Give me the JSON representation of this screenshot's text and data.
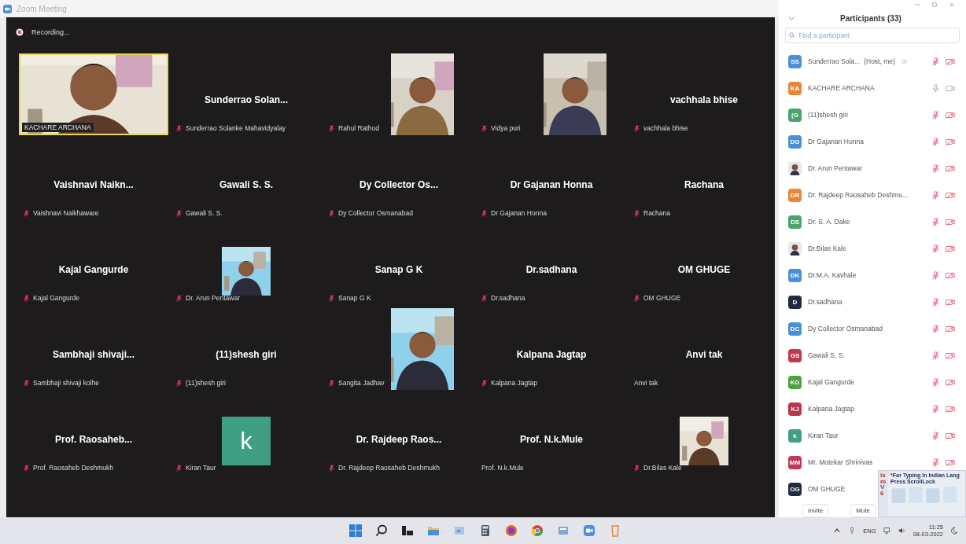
{
  "window": {
    "title": "Zoom Meeting"
  },
  "recording": {
    "label": "Recording..."
  },
  "tiles": [
    {
      "kind": "video",
      "active": true,
      "label": "KACHARE ARCHANA",
      "muted": false
    },
    {
      "kind": "name",
      "name": "Sunderrao  Solan...",
      "label": "Sunderrao Solanke Mahavidyalay",
      "muted": true
    },
    {
      "kind": "video",
      "label": "Rahul Rathod",
      "muted": true
    },
    {
      "kind": "video",
      "label": "Vidya puri",
      "muted": true
    },
    {
      "kind": "name",
      "name": "vachhala bhise",
      "label": "vachhala bhise",
      "muted": true
    },
    {
      "kind": "name",
      "name": "Vaishnavi  Naikn...",
      "label": "Vaishnavi Naikhaware",
      "muted": true
    },
    {
      "kind": "name",
      "name": "Gawali S. S.",
      "label": "Gawali S. S.",
      "muted": true
    },
    {
      "kind": "name",
      "name": "Dy Collector Os...",
      "label": "Dy Collector Osmanabad",
      "muted": true
    },
    {
      "kind": "name",
      "name": "Dr Gajanan Honna",
      "label": "Dr Gajanan Honna",
      "muted": true
    },
    {
      "kind": "name",
      "name": "Rachana",
      "label": "Rachana",
      "muted": true
    },
    {
      "kind": "name",
      "name": "Kajal Gangurde",
      "label": "Kajal Gangurde",
      "muted": true
    },
    {
      "label": "Dr. Arun Pentawar",
      "muted": true
    },
    {
      "kind": "name",
      "name": "Sanap G K",
      "label": "Sanap G K",
      "muted": true
    },
    {
      "kind": "name",
      "name": "Dr.sadhana",
      "label": "Dr.sadhana",
      "muted": true
    },
    {
      "kind": "name",
      "name": "OM GHUGE",
      "label": "OM GHUGE",
      "muted": true
    },
    {
      "kind": "name",
      "name": "Sambhaji  shivaji...",
      "label": "Sambhaji shivaji kolhe",
      "muted": true
    },
    {
      "kind": "name",
      "name": "(11)shesh giri",
      "label": "(11)shesh giri",
      "muted": true
    },
    {
      "kind": "video",
      "label": "Sangita Jadhav",
      "muted": true
    },
    {
      "kind": "name",
      "name": "Kalpana Jagtap",
      "label": "Kalpana Jagtap",
      "muted": true
    },
    {
      "kind": "name",
      "name": "Anvi tak",
      "label": "Anvi tak",
      "muted": false
    },
    {
      "kind": "name",
      "name": "Prof.  Raosaheb...",
      "label": "Prof. Raosaheb Deshmukh",
      "muted": true
    },
    {
      "kind": "letter",
      "letter": "k",
      "color": "#3f9e84",
      "label": "Kiran Taur",
      "muted": true
    },
    {
      "kind": "name",
      "name": "Dr. Rajdeep  Raos...",
      "label": "Dr. Rajdeep Raosaheb Deshmukh",
      "muted": true
    },
    {
      "kind": "name",
      "name": "Prof. N.k.Mule",
      "label": "Prof. N.k.Mule",
      "muted": false
    },
    {
      "label": "Dr.Bilas Kale",
      "muted": true
    }
  ],
  "participants_panel": {
    "title": "Participants (33)",
    "search": {
      "placeholder": "Find a participant"
    },
    "participants": [
      {
        "kind": "initials",
        "initials": "SS",
        "color": "#4a90d9",
        "name": "Sunderrao Sola...",
        "role": "(Host, me)",
        "muted": true,
        "video_on": false
      },
      {
        "kind": "initials",
        "initials": "KA",
        "color": "#e8873a",
        "name": "KACHARE ARCHANA",
        "muted": false,
        "video_on": true
      },
      {
        "kind": "initials",
        "initials": "(G",
        "color": "#4aa36b",
        "name": "(11)shesh giri",
        "muted": true,
        "video_on": false
      },
      {
        "kind": "initials",
        "initials": "DG",
        "color": "#4a90d9",
        "name": "Dr Gajanan Honna",
        "muted": true,
        "video_on": false
      },
      {
        "name": "Dr. Arun Pentawar",
        "muted": true,
        "video_on": false
      },
      {
        "kind": "initials",
        "initials": "DR",
        "color": "#e8873a",
        "name": "Dr. Rajdeep Raosaheb Deshmu...",
        "muted": true,
        "video_on": false
      },
      {
        "kind": "initials",
        "initials": "DS",
        "color": "#4aa36b",
        "name": "Dr. S. A. Dake",
        "muted": true,
        "video_on": false
      },
      {
        "name": "Dr.Bilas Kale",
        "muted": true,
        "video_on": false
      },
      {
        "kind": "initials",
        "initials": "DK",
        "color": "#4a90d9",
        "name": "Dr.M.A. Kavhale",
        "muted": true,
        "video_on": false
      },
      {
        "kind": "initials",
        "initials": "D",
        "color": "#1f2b3e",
        "name": "Dr.sadhana",
        "muted": true,
        "video_on": false
      },
      {
        "kind": "initials",
        "initials": "DC",
        "color": "#4a90d9",
        "name": "Dy Collector Osmanabad",
        "muted": true,
        "video_on": false
      },
      {
        "kind": "initials",
        "initials": "GS",
        "color": "#c0394b",
        "name": "Gawali S. S.",
        "muted": true,
        "video_on": false
      },
      {
        "kind": "initials",
        "initials": "KG",
        "color": "#4aa33f",
        "name": "Kajal Gangurde",
        "muted": true,
        "video_on": false
      },
      {
        "kind": "initials",
        "initials": "KJ",
        "color": "#b8374a",
        "name": "Kalpana Jagtap",
        "muted": true,
        "video_on": false
      },
      {
        "kind": "initials",
        "initials": "k",
        "color": "#3f9e84",
        "name": "Kiran Taur",
        "muted": true,
        "video_on": false
      },
      {
        "kind": "initials",
        "initials": "MM",
        "color": "#c0395a",
        "name": "Mr. Motekar Shrinivas",
        "muted": true,
        "video_on": false
      },
      {
        "kind": "initials",
        "initials": "OG",
        "color": "#1f2b3e",
        "name": "OM GHUGE"
      }
    ],
    "buttons": [
      "Invite",
      "Mute"
    ]
  },
  "ism_popup": {
    "badge": "ism V6",
    "text": "*For Typing In Indian Lang Press ScrollLock"
  },
  "taskbar": {
    "language": "ENG",
    "time": "11:25",
    "date": "08-03-2022"
  }
}
